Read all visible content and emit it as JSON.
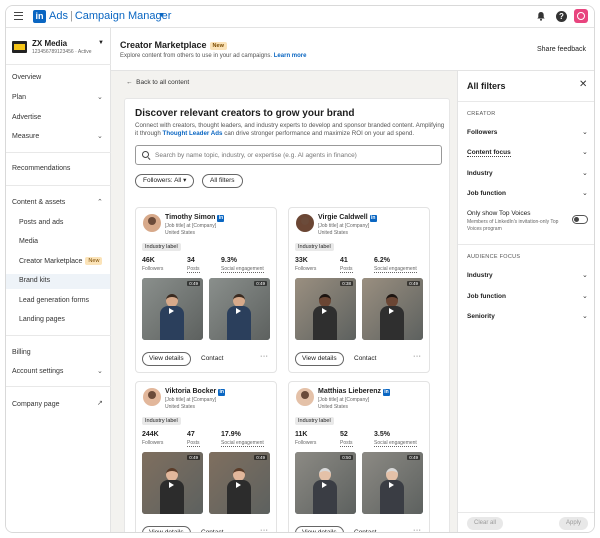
{
  "topbar": {
    "brand_ads": "Ads",
    "brand_cm": "Campaign Manager"
  },
  "account": {
    "name": "ZX Media",
    "sub": "123456789123456 · Active"
  },
  "sidebar": {
    "overview": "Overview",
    "plan": "Plan",
    "advertise": "Advertise",
    "measure": "Measure",
    "recommendations": "Recommendations",
    "content_assets": "Content & assets",
    "posts_ads": "Posts and ads",
    "media": "Media",
    "creator_marketplace": "Creator Marketplace",
    "new_badge": "New",
    "brand_kits": "Brand kits",
    "lead_gen": "Lead generation forms",
    "landing_pages": "Landing pages",
    "billing": "Billing",
    "account_settings": "Account settings",
    "company_page": "Company page"
  },
  "header": {
    "title": "Creator Marketplace",
    "badge": "New",
    "subtitle": "Explore content from others to use in your ad campaigns.",
    "learn_more": "Learn more",
    "share_feedback": "Share feedback"
  },
  "main": {
    "back": "Back to all content",
    "title": "Discover relevant creators to grow your brand",
    "desc_1": "Connect with creators, thought leaders, and industry experts to develop and sponsor branded content. Amplifying it through",
    "desc_link": "Thought Leader Ads",
    "desc_2": "can drive stronger performance and maximize ROI on your ad spend.",
    "search_placeholder": "Search by name topic, industry, or expertise (e.g. AI agents in finance)",
    "followers_pill": "Followers: All",
    "all_filters_pill": "All filters"
  },
  "creators": [
    {
      "name": "Timothy Simon",
      "job": "[Job title] at [Company]",
      "loc": "United States",
      "label": "Industry label",
      "followers": "46K",
      "posts": "34",
      "engagement": "9.3%",
      "dur1": "0:49",
      "dur2": "0:49"
    },
    {
      "name": "Virgie Caldwell",
      "job": "[Job title] at [Company]",
      "loc": "United States",
      "label": "Industry label",
      "followers": "33K",
      "posts": "41",
      "engagement": "6.2%",
      "dur1": "0:38",
      "dur2": "0:49"
    },
    {
      "name": "Viktoria Bocker",
      "job": "[Job title] at [Company]",
      "loc": "United States",
      "label": "Industry label",
      "followers": "244K",
      "posts": "47",
      "engagement": "17.9%",
      "dur1": "0:49",
      "dur2": "0:49"
    },
    {
      "name": "Matthias Lieberenz",
      "job": "[Job title] at [Company]",
      "loc": "United States",
      "label": "Industry label",
      "followers": "11K",
      "posts": "52",
      "engagement": "3.5%",
      "dur1": "0:50",
      "dur2": "0:49"
    }
  ],
  "card_labels": {
    "followers": "Followers",
    "posts": "Posts",
    "engagement": "Social engagement",
    "view_details": "View details",
    "contact": "Contact"
  },
  "filters": {
    "title": "All filters",
    "creator_section": "CREATOR",
    "followers": "Followers",
    "content_focus": "Content focus",
    "industry": "Industry",
    "job_function": "Job function",
    "top_voices": "Only show Top Voices",
    "top_voices_sub": "Members of LinkedIn's invitation-only Top Voices program",
    "audience_section": "AUDIENCE FOCUS",
    "aud_industry": "Industry",
    "aud_job_function": "Job function",
    "aud_seniority": "Seniority",
    "clear_all": "Clear all",
    "apply": "Apply"
  },
  "colors": {
    "accent": "#0a66c2",
    "badge_new": "#fbe3b8"
  }
}
